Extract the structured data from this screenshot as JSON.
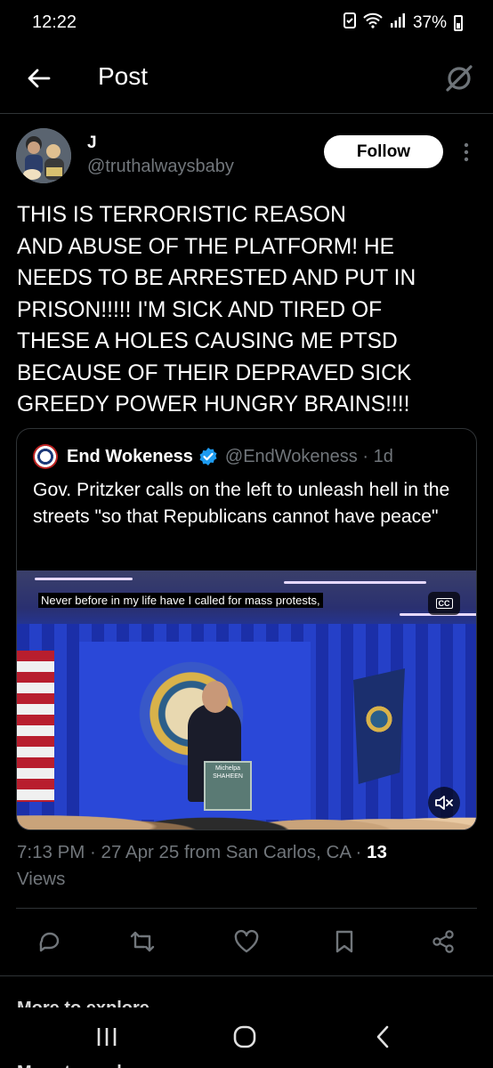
{
  "status_bar": {
    "time": "12:22",
    "battery": "37%"
  },
  "header": {
    "title": "Post"
  },
  "author": {
    "name": "J",
    "handle": "@truthalwaysbaby",
    "follow_label": "Follow"
  },
  "post": {
    "text": "THIS IS TERRORISTIC REASON\nAND ABUSE OF THE PLATFORM! HE\nNEEDS TO BE ARRESTED AND PUT IN\nPRISON!!!!! I'M SICK AND TIRED OF\nTHESE A HOLES CAUSING ME PTSD\nBECAUSE OF THEIR DEPRAVED SICK\nGREEDY POWER HUNGRY BRAINS!!!!"
  },
  "quote": {
    "name": "End Wokeness",
    "handle_time": "@EndWokeness · 1d",
    "text": "Gov. Pritzker calls on the left to unleash hell in the streets \"so that Republicans cannot have peace\"",
    "video": {
      "caption": "Never before in my life have I called for mass protests,",
      "cc_label": "CC",
      "podium_text": "Michelpa SHAHEEN"
    }
  },
  "meta": {
    "time_date_source": "7:13 PM · 27 Apr 25 from San Carlos, CA · ",
    "views_count": "13",
    "views_label": "Views"
  },
  "more_replies": "More to explore"
}
